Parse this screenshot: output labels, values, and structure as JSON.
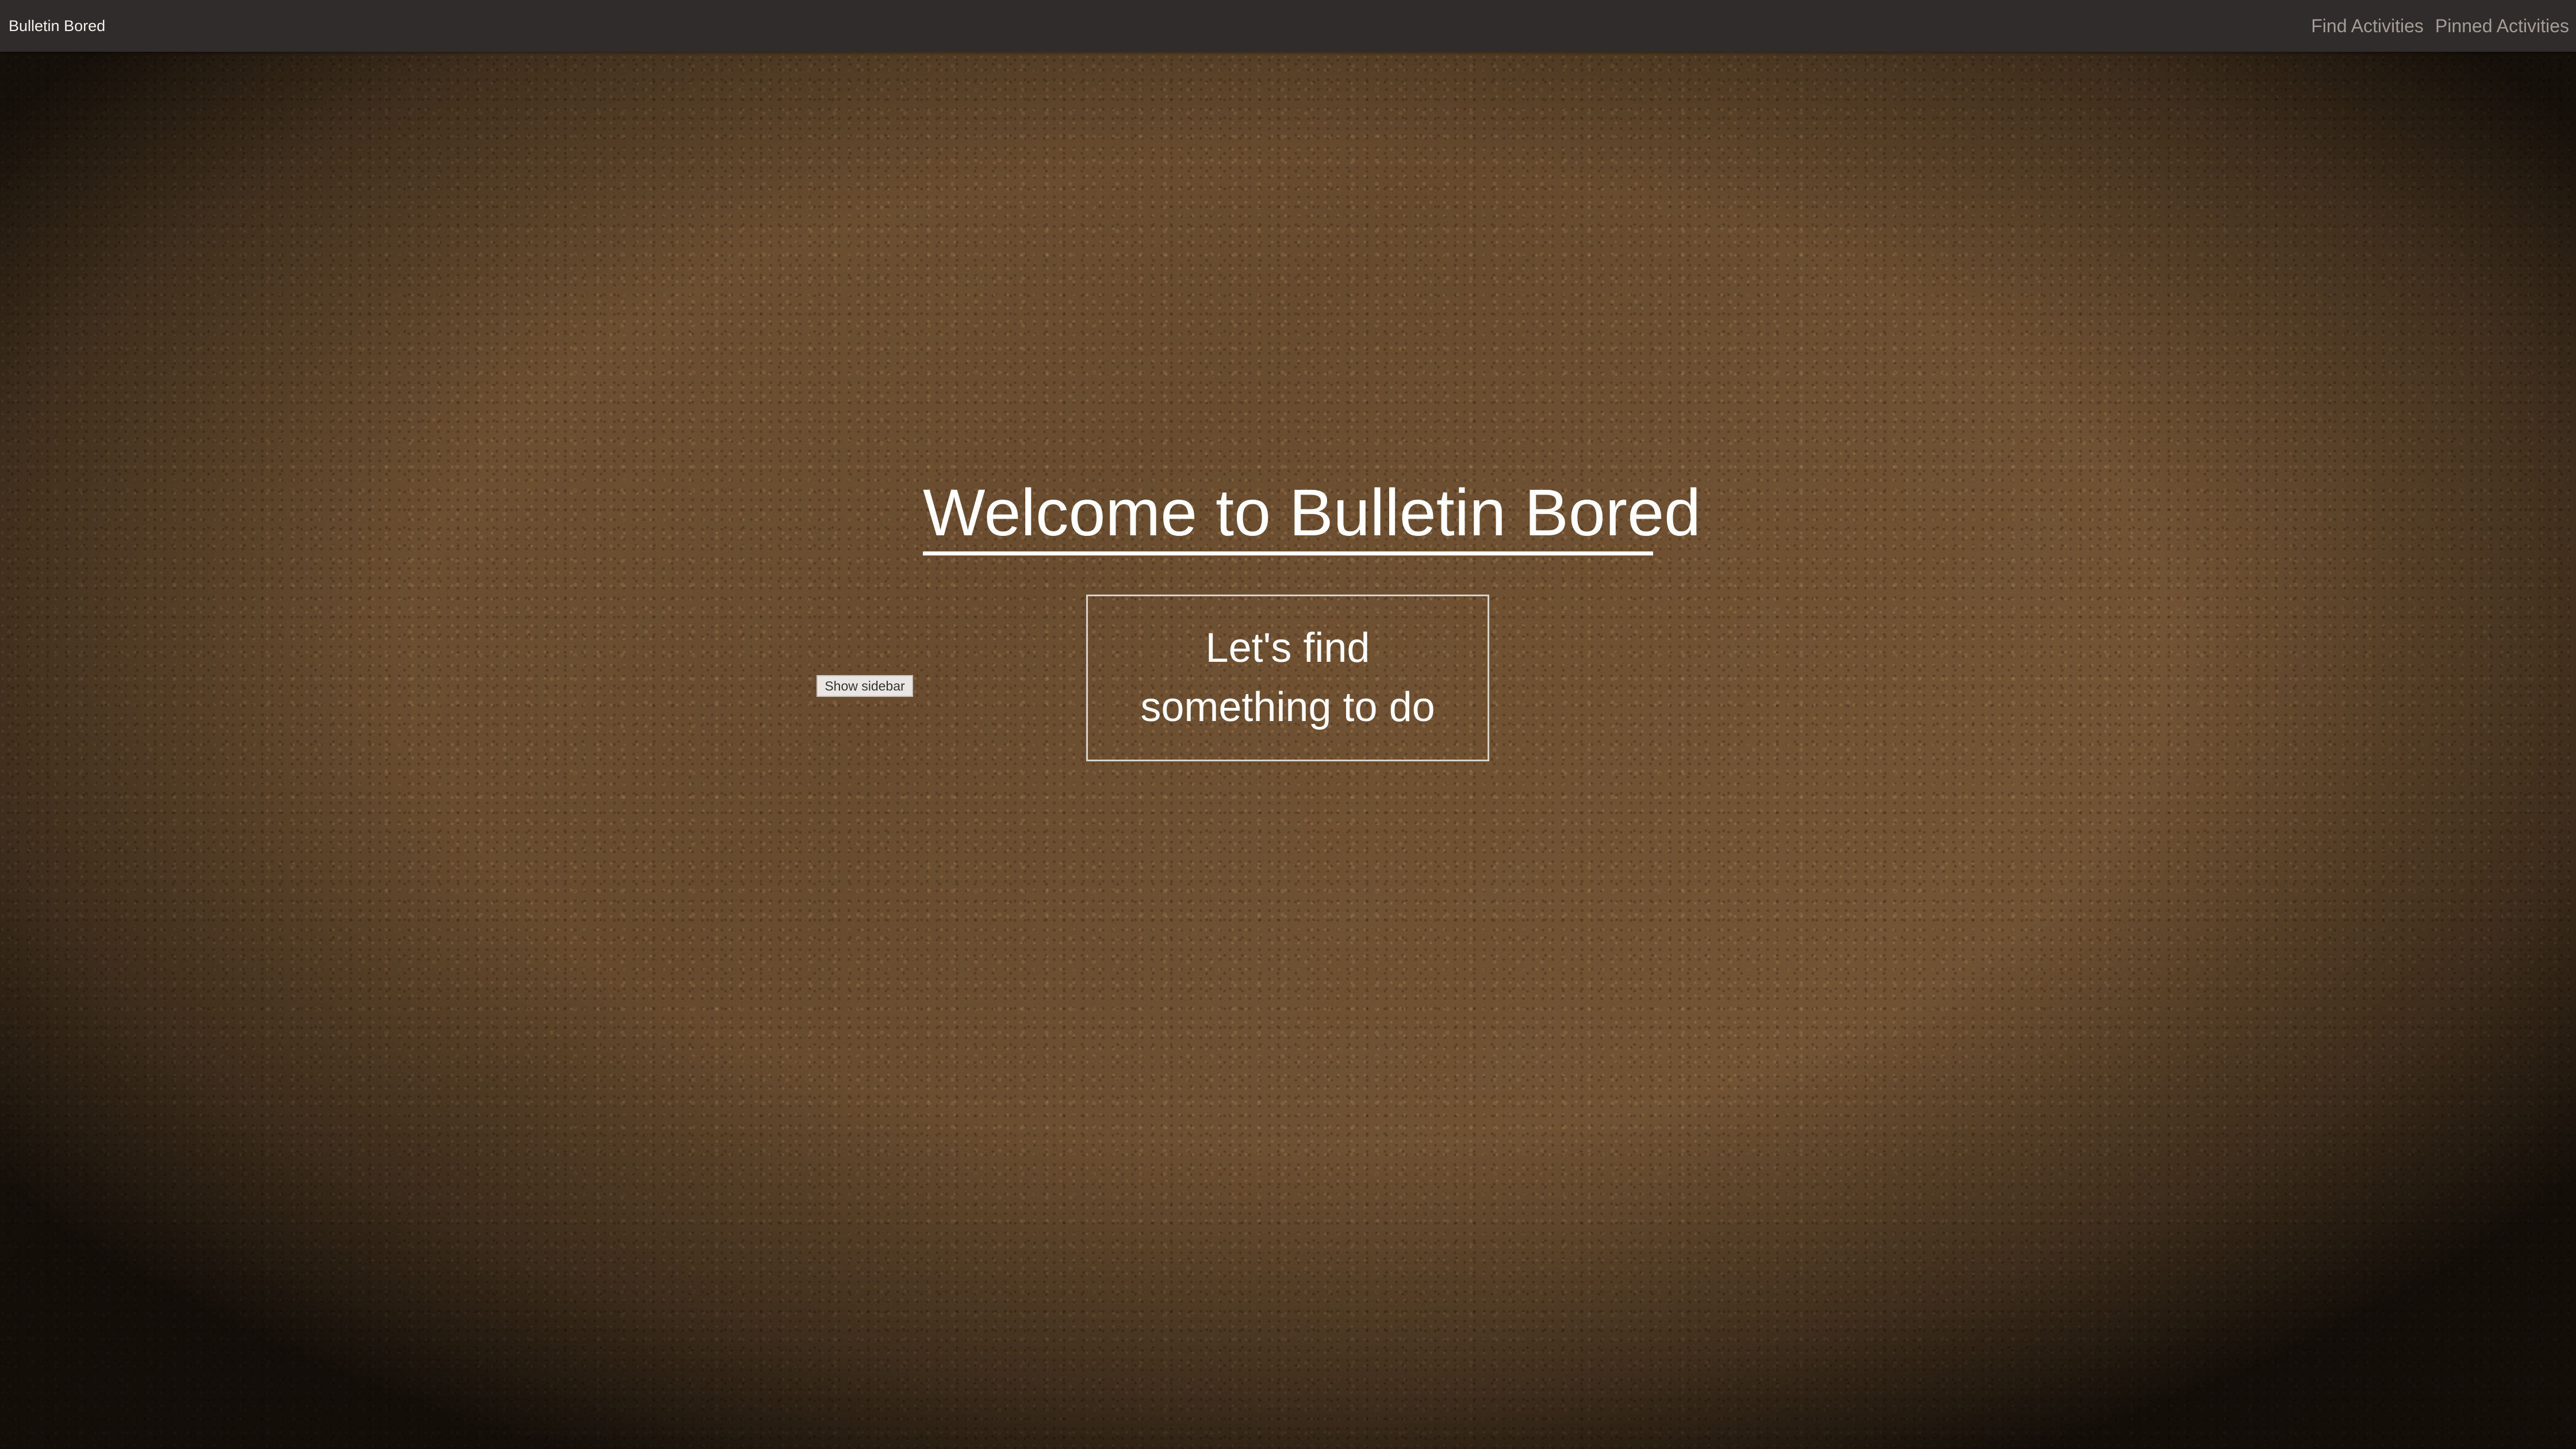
{
  "navbar": {
    "brand": "Bulletin Bored",
    "links": [
      {
        "label": "Find Activities"
      },
      {
        "label": "Pinned Activities"
      }
    ]
  },
  "hero": {
    "title": "Welcome to Bulletin Bored",
    "cta": "Let's find something to do"
  },
  "sidebar_toggle": {
    "label": "Show sidebar"
  },
  "colors": {
    "navbar_bg": "#312c2c",
    "text": "#ffffff",
    "nav_link": "#a39c97"
  }
}
